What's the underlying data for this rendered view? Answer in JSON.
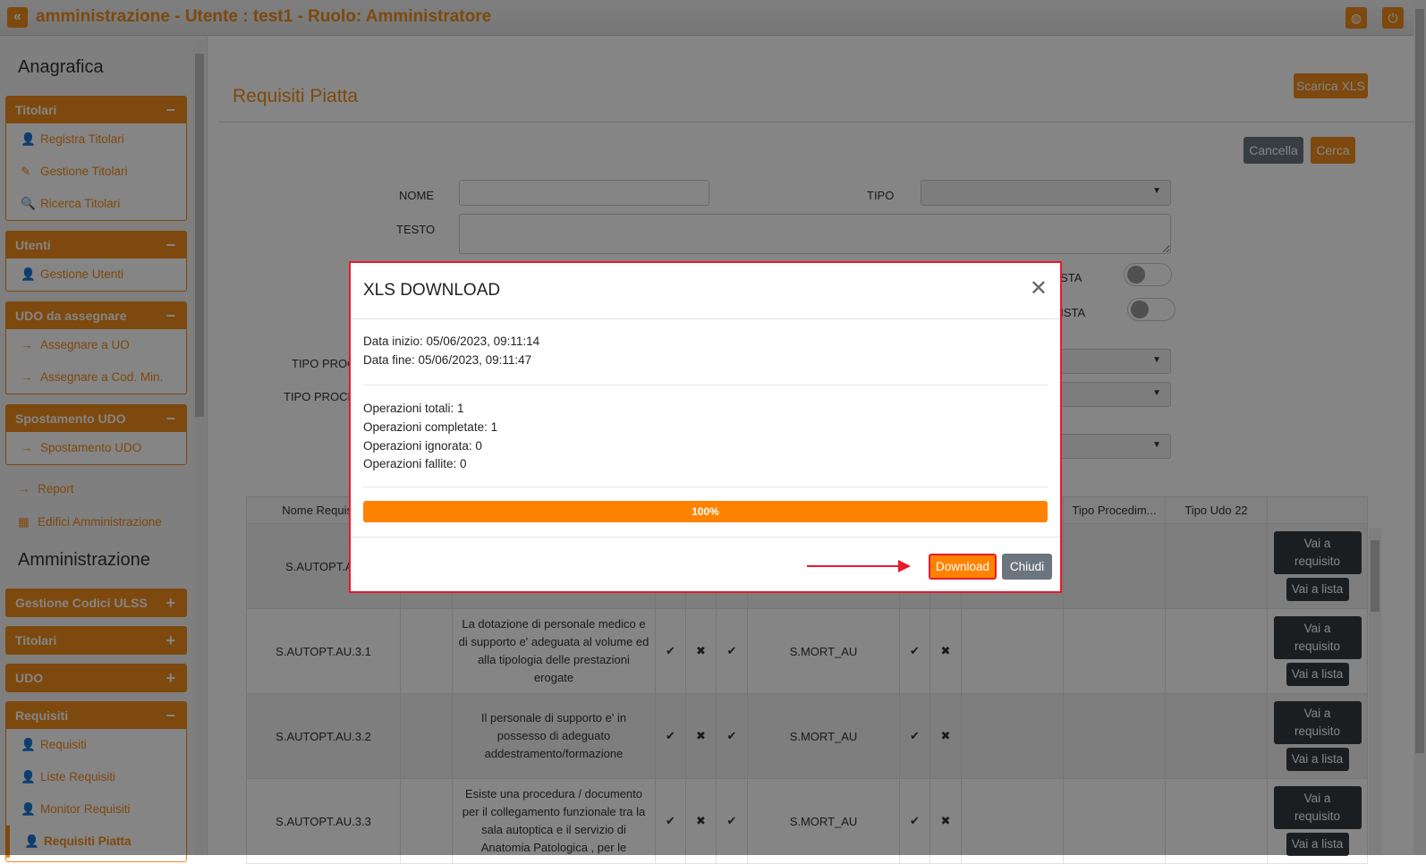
{
  "header": {
    "title": "amministrazione - Utente : test1 - Ruolo: Amministratore",
    "back_icon": "double-chevron-left-icon",
    "icons": [
      "globe-icon",
      "power-icon"
    ]
  },
  "sidebar": {
    "section1": "Anagrafica",
    "titolari": {
      "title": "Titolari",
      "toggle": "−",
      "items": [
        {
          "label": "Registra Titolari",
          "icon": "user-edit-icon"
        },
        {
          "label": "Gestione Titolari",
          "icon": "edit-icon"
        },
        {
          "label": "Ricerca Titolari",
          "icon": "search-icon"
        }
      ]
    },
    "utenti": {
      "title": "Utenti",
      "toggle": "−",
      "items": [
        {
          "label": "Gestione Utenti",
          "icon": "user-edit-icon"
        }
      ]
    },
    "udo": {
      "title": "UDO da assegnare",
      "toggle": "−",
      "items": [
        {
          "label": "Assegnare a UO",
          "icon": "arrow-right-icon"
        },
        {
          "label": "Assegnare a Cod. Min.",
          "icon": "arrow-right-icon"
        }
      ]
    },
    "spost": {
      "title": "Spostamento UDO",
      "toggle": "−",
      "items": [
        {
          "label": "Spostamento UDO",
          "icon": "arrow-right-icon"
        }
      ]
    },
    "links": [
      {
        "label": "Report",
        "icon": "arrow-right-icon"
      },
      {
        "label": "Edifici Amministrazione",
        "icon": "building-icon"
      }
    ],
    "section2": "Amministrazione",
    "collapsed": [
      {
        "title": "Gestione Codici ULSS",
        "toggle": "+"
      },
      {
        "title": "Titolari",
        "toggle": "+"
      },
      {
        "title": "UDO",
        "toggle": "+"
      }
    ],
    "requisiti": {
      "title": "Requisiti",
      "toggle": "−",
      "items": [
        {
          "label": "Requisiti",
          "icon": "user-edit-icon"
        },
        {
          "label": "Liste Requisiti",
          "icon": "user-edit-icon"
        },
        {
          "label": "Monitor Requisiti",
          "icon": "user-edit-icon"
        },
        {
          "label": "Requisiti Piatta",
          "icon": "user-edit-icon"
        }
      ]
    }
  },
  "main": {
    "title": "Requisiti Piatta",
    "download_xls": "Scarica XLS",
    "cancel": "Cancella",
    "search": "Cerca",
    "form": {
      "nome_label": "NOME",
      "nome_value": "",
      "tipo_label": "TIPO",
      "tipo_value": "",
      "testo_label": "TESTO",
      "testo_value": "",
      "toggle1_label": "OSTA",
      "toggle2_label": "LISTA",
      "tipo_proc1_label": "TIPO PROC",
      "tipo_proc2_label": "TIPO PROCE"
    },
    "table": {
      "headers": [
        "Nome Requisito",
        "",
        "",
        "",
        "",
        "",
        "",
        "",
        "",
        "",
        "Tipo Procedim...",
        "Tipo Udo 22",
        ""
      ],
      "rows": [
        {
          "name": "S.AUTOPT.AU",
          "desc": "",
          "c1": "",
          "c2": "",
          "c3": "",
          "code": "",
          "c4": "",
          "c5": ""
        },
        {
          "name": "S.AUTOPT.AU.3.1",
          "desc": "La dotazione di personale medico e di supporto e' adeguata al volume ed alla tipologia delle prestazioni erogate",
          "c1": "✔",
          "c2": "✖",
          "c3": "✔",
          "code": "S.MORT_AU",
          "c4": "✔",
          "c5": "✖"
        },
        {
          "name": "S.AUTOPT.AU.3.2",
          "desc": "Il personale di supporto e' in possesso di adeguato addestramento/formazione",
          "c1": "✔",
          "c2": "✖",
          "c3": "✔",
          "code": "S.MORT_AU",
          "c4": "✔",
          "c5": "✖"
        },
        {
          "name": "S.AUTOPT.AU.3.3",
          "desc": "Esiste una procedura / documento per il collegamento funzionale tra la sala autoptica e il servizio di Anatomia Patologica , per le",
          "c1": "✔",
          "c2": "✖",
          "c3": "✔",
          "code": "S.MORT_AU",
          "c4": "✔",
          "c5": "✖"
        }
      ],
      "action_requisito": "Vai a requisito",
      "action_lista": "Vai a lista"
    }
  },
  "modal": {
    "title": "XLS DOWNLOAD",
    "start": "Data inizio: 05/06/2023, 09:11:14",
    "end": "Data fine: 05/06/2023, 09:11:47",
    "totali": "Operazioni totali: 1",
    "completate": "Operazioni completate: 1",
    "ignorate": "Operazioni ignorata: 0",
    "fallite": "Operazioni fallite: 0",
    "progress": 100,
    "progress_label": "100%",
    "progress_color": "#ff8200",
    "download": "Download",
    "close": "Chiudi"
  }
}
